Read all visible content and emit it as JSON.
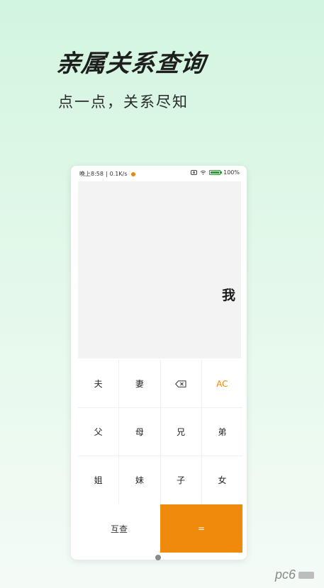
{
  "promo": {
    "title": "亲属关系查询",
    "subtitle": "点一点，关系尽知"
  },
  "status_bar": {
    "time": "晚上8:58",
    "separator": "|",
    "speed": "0.1K/s",
    "battery": "100%"
  },
  "display": {
    "value": "我"
  },
  "keypad": {
    "rows": [
      [
        "夫",
        "妻",
        "",
        "AC"
      ],
      [
        "父",
        "母",
        "兄",
        "弟"
      ],
      [
        "姐",
        "妹",
        "子",
        "女"
      ]
    ],
    "mutual_label": "互查",
    "equals_label": "="
  },
  "colors": {
    "accent": "#f08a0c",
    "background_top": "#d2f5df",
    "display_bg": "#f3f3f3"
  },
  "icons": {
    "backspace": "backspace-icon",
    "camera": "camera-icon",
    "wifi": "wifi-icon",
    "battery": "battery-icon"
  },
  "watermark": {
    "text": "pc6"
  }
}
